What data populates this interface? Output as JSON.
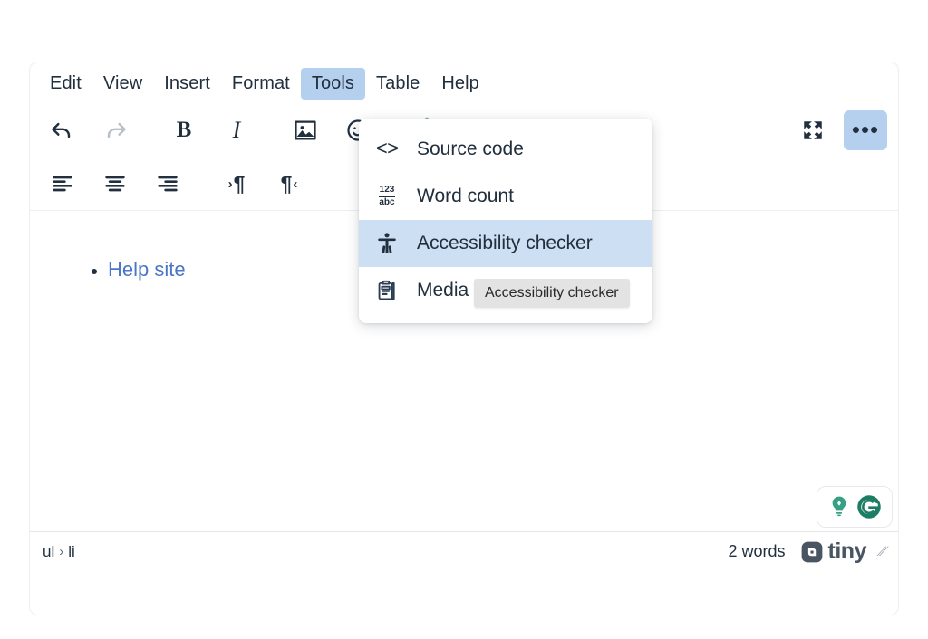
{
  "editor": {
    "menubar": [
      {
        "label": "Edit",
        "name": "menubar-item-edit",
        "active": false
      },
      {
        "label": "View",
        "name": "menubar-item-view",
        "active": false
      },
      {
        "label": "Insert",
        "name": "menubar-item-insert",
        "active": false
      },
      {
        "label": "Format",
        "name": "menubar-item-format",
        "active": false
      },
      {
        "label": "Tools",
        "name": "menubar-item-tools",
        "active": true
      },
      {
        "label": "Table",
        "name": "menubar-item-table",
        "active": false
      },
      {
        "label": "Help",
        "name": "menubar-item-help",
        "active": false
      }
    ],
    "toolbar_row1": [
      {
        "icon": "undo-icon",
        "glyph": "↶"
      },
      {
        "icon": "redo-icon",
        "glyph": "↷"
      },
      {
        "icon": "bold-icon",
        "glyph": "B"
      },
      {
        "icon": "italic-icon",
        "glyph": "I"
      },
      {
        "icon": "image-icon",
        "glyph": "image"
      },
      {
        "icon": "emoticons-icon",
        "glyph": "emoticon"
      },
      {
        "icon": "media-play-icon",
        "glyph": "hexagon-play"
      },
      {
        "icon": "fullscreen-icon",
        "glyph": "fullscreen"
      },
      {
        "icon": "more-options-icon",
        "glyph": "•••"
      }
    ],
    "toolbar_row2": [
      {
        "icon": "align-left-icon",
        "glyph": "align-left"
      },
      {
        "icon": "align-center-icon",
        "glyph": "align-center"
      },
      {
        "icon": "align-right-icon",
        "glyph": "align-right"
      },
      {
        "icon": "ltr-icon",
        "glyph": "ltr"
      },
      {
        "icon": "rtl-icon",
        "glyph": "rtl"
      }
    ],
    "content": {
      "list_items": [
        {
          "text": "Help site",
          "is_link": true
        }
      ]
    },
    "statusbar": {
      "path_root": "ul",
      "path_separator": "›",
      "path_leaf": "li",
      "wordcount": "2 words",
      "brand": "tiny",
      "resize_handle": "⁄⁄"
    },
    "grammarly": {
      "name": "grammarly-widget",
      "bulb_color": "#35a083",
      "logo_color": "#1d7d64"
    }
  },
  "tools_menu": {
    "items": [
      {
        "label": "Source code",
        "icon": "source-code-icon",
        "selected": false
      },
      {
        "label": "Word count",
        "icon": "word-count-icon",
        "selected": false
      },
      {
        "label": "Accessibility checker",
        "icon": "accessibility-icon",
        "selected": true
      },
      {
        "label": "Media",
        "icon": "clipboard-icon",
        "selected": false
      }
    ],
    "wordcount_icon_top": "123",
    "wordcount_icon_bottom": "abc",
    "source_code_glyph": "<>"
  },
  "tooltip": {
    "text": "Accessibility checker"
  },
  "colors": {
    "accent_highlight": "#b4d0ee",
    "menu_selected": "#cddff2",
    "text": "#222f3e",
    "link": "#4a76c8",
    "tooltip_bg": "#e3e3e3"
  }
}
